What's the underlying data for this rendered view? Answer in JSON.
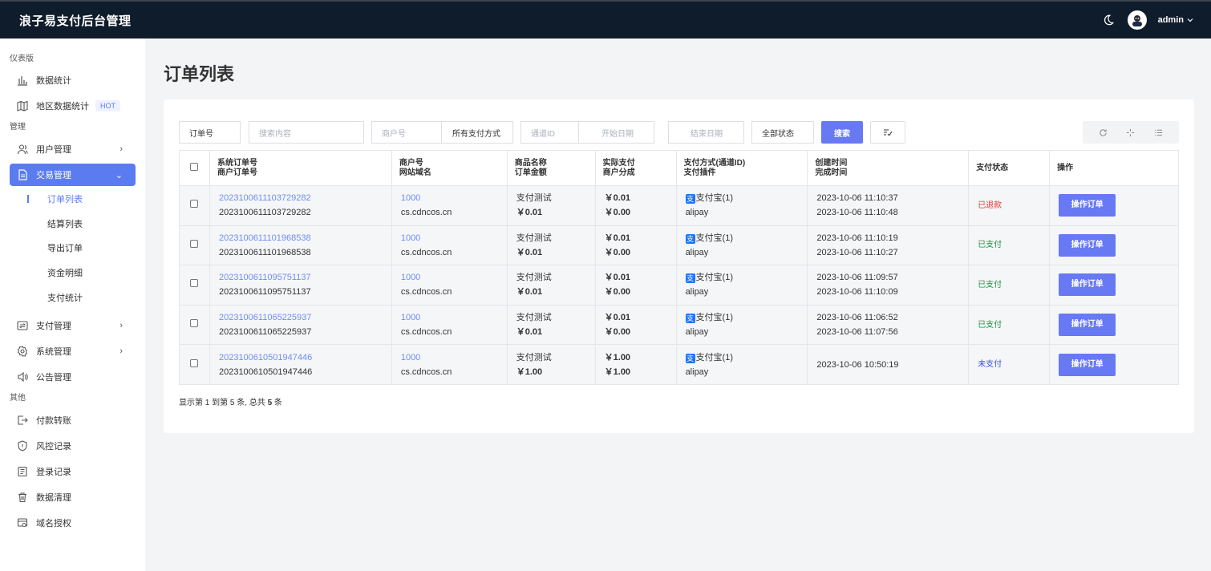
{
  "app": {
    "title": "浪子易支付后台管理",
    "user": "admin"
  },
  "sidebar": {
    "sections": [
      "仪表版",
      "管理",
      "其他"
    ],
    "dashboard": [
      {
        "label": "数据统计",
        "icon": "bar-chart-icon"
      },
      {
        "label": "地区数据统计",
        "icon": "map-icon",
        "badge": "HOT"
      }
    ],
    "manage": [
      {
        "label": "用户管理",
        "icon": "users-icon"
      },
      {
        "label": "交易管理",
        "icon": "document-icon"
      }
    ],
    "trade_sub": [
      "订单列表",
      "结算列表",
      "导出订单",
      "资金明细",
      "支付统计"
    ],
    "manage2": [
      {
        "label": "支付管理",
        "icon": "transfer-icon"
      },
      {
        "label": "系统管理",
        "icon": "gear-icon"
      },
      {
        "label": "公告管理",
        "icon": "speaker-icon"
      }
    ],
    "other": [
      {
        "label": "付款转账",
        "icon": "export-icon"
      },
      {
        "label": "风控记录",
        "icon": "shield-icon"
      },
      {
        "label": "登录记录",
        "icon": "log-icon"
      },
      {
        "label": "数据清理",
        "icon": "trash-icon"
      },
      {
        "label": "域名授权",
        "icon": "domain-icon"
      }
    ]
  },
  "page": {
    "title": "订单列表"
  },
  "filters": {
    "type_select": "订单号",
    "keyword_placeholder": "搜索内容",
    "merchant_placeholder": "商户号",
    "pay_type": "所有支付方式",
    "channel_placeholder": "通道ID",
    "start_placeholder": "开始日期",
    "end_placeholder": "结束日期",
    "status": "全部状态",
    "search": "搜索"
  },
  "table": {
    "headers": [
      [
        "系统订单号",
        "商户订单号"
      ],
      [
        "商户号",
        "网站域名"
      ],
      [
        "商品名称",
        "订单金额"
      ],
      [
        "实际支付",
        "商户分成"
      ],
      [
        "支付方式(通道ID)",
        "支付插件"
      ],
      [
        "创建时间",
        "完成时间"
      ],
      [
        "支付状态"
      ],
      [
        "操作"
      ]
    ],
    "rows": [
      {
        "trade_no": "2023100611103729282",
        "out_trade_no": "2023100611103729282",
        "uid": "1000",
        "domain": "cs.cdncos.cn",
        "name": "支付测试",
        "money": "￥0.01",
        "realmoney": "￥0.01",
        "getmoney": "￥0.00",
        "paytype": "支付宝(1)",
        "plugin": "alipay",
        "addtime": "2023-10-06 11:10:37",
        "endtime": "2023-10-06 11:10:48",
        "status": "已退款",
        "status_color": "#e53935",
        "op": "操作订单"
      },
      {
        "trade_no": "2023100611101968538",
        "out_trade_no": "2023100611101968538",
        "uid": "1000",
        "domain": "cs.cdncos.cn",
        "name": "支付测试",
        "money": "￥0.01",
        "realmoney": "￥0.01",
        "getmoney": "￥0.00",
        "paytype": "支付宝(1)",
        "plugin": "alipay",
        "addtime": "2023-10-06 11:10:19",
        "endtime": "2023-10-06 11:10:27",
        "status": "已支付",
        "status_color": "#1e8e3e",
        "op": "操作订单"
      },
      {
        "trade_no": "2023100611095751137",
        "out_trade_no": "2023100611095751137",
        "uid": "1000",
        "domain": "cs.cdncos.cn",
        "name": "支付测试",
        "money": "￥0.01",
        "realmoney": "￥0.01",
        "getmoney": "￥0.00",
        "paytype": "支付宝(1)",
        "plugin": "alipay",
        "addtime": "2023-10-06 11:09:57",
        "endtime": "2023-10-06 11:10:09",
        "status": "已支付",
        "status_color": "#1e8e3e",
        "op": "操作订单"
      },
      {
        "trade_no": "2023100611065225937",
        "out_trade_no": "2023100611065225937",
        "uid": "1000",
        "domain": "cs.cdncos.cn",
        "name": "支付测试",
        "money": "￥0.01",
        "realmoney": "￥0.01",
        "getmoney": "￥0.00",
        "paytype": "支付宝(1)",
        "plugin": "alipay",
        "addtime": "2023-10-06 11:06:52",
        "endtime": "2023-10-06 11:07:56",
        "status": "已支付",
        "status_color": "#1e8e3e",
        "op": "操作订单"
      },
      {
        "trade_no": "2023100610501947446",
        "out_trade_no": "2023100610501947446",
        "uid": "1000",
        "domain": "cs.cdncos.cn",
        "name": "支付测试",
        "money": "￥1.00",
        "realmoney": "￥1.00",
        "getmoney": "￥1.00",
        "paytype": "支付宝(1)",
        "plugin": "alipay",
        "addtime": "2023-10-06 10:50:19",
        "endtime": "",
        "status": "未支付",
        "status_color": "#3b4fd8",
        "op": "操作订单"
      }
    ]
  },
  "pagination": {
    "text_a": "显示第 1 到第 5 条, 总共 ",
    "total": "5",
    "text_b": " 条"
  }
}
